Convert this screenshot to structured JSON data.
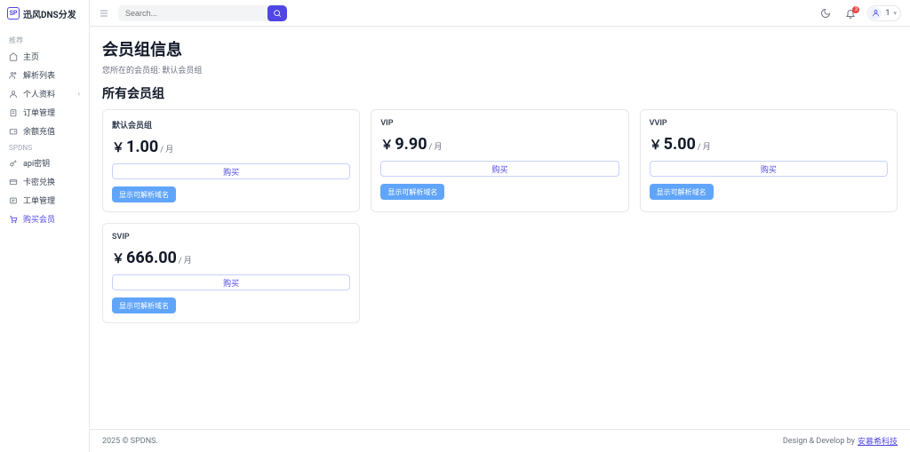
{
  "brand": {
    "badge": "SP",
    "name": "迅风DNS分发"
  },
  "search": {
    "placeholder": "Search..."
  },
  "notifications": {
    "count": "3"
  },
  "user": {
    "label": "1"
  },
  "nav": {
    "section1": "推荐",
    "items1": [
      {
        "label": "主页"
      },
      {
        "label": "解析列表"
      },
      {
        "label": "个人资料",
        "expandable": true
      },
      {
        "label": "订单管理"
      },
      {
        "label": "余额充值"
      }
    ],
    "section2": "SPDNS",
    "items2": [
      {
        "label": "api密钥"
      },
      {
        "label": "卡密兑换"
      },
      {
        "label": "工单管理"
      },
      {
        "label": "购买会员",
        "active": true
      }
    ]
  },
  "page": {
    "title": "会员组信息",
    "subtitle_prefix": "您所在的会员组:",
    "subtitle_value": "默认会员组",
    "section": "所有会员组"
  },
  "groups": [
    {
      "name": "默认会员组",
      "currency": "￥",
      "amount": "1.00",
      "unit": "/ 月",
      "buy": "购买",
      "show": "显示可解析域名"
    },
    {
      "name": "VIP",
      "currency": "￥",
      "amount": "9.90",
      "unit": "/ 月",
      "buy": "购买",
      "show": "显示可解析域名"
    },
    {
      "name": "VVIP",
      "currency": "￥",
      "amount": "5.00",
      "unit": "/ 月",
      "buy": "购买",
      "show": "显示可解析域名"
    },
    {
      "name": "SVIP",
      "currency": "￥",
      "amount": "666.00",
      "unit": "/ 月",
      "buy": "购买",
      "show": "显示可解析域名"
    }
  ],
  "footer": {
    "left": "2025 © SPDNS.",
    "right_text": "Design & Develop by",
    "right_link": "安慕希科技"
  }
}
